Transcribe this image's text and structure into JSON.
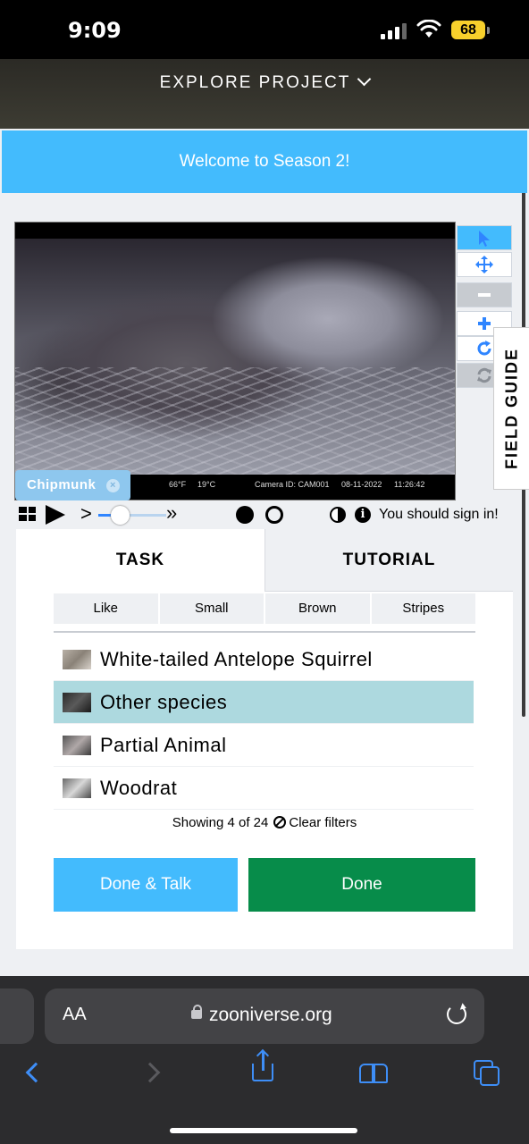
{
  "status_bar": {
    "time": "9:09",
    "battery": "68"
  },
  "header": {
    "explore_label": "EXPLORE PROJECT"
  },
  "banner": {
    "text": "Welcome to Season 2!"
  },
  "viewer": {
    "info": {
      "temp_f": "66°F",
      "temp_c": "19°C",
      "camera": "Camera ID: CAM001",
      "date": "08-11-2022",
      "time": "11:26:42"
    },
    "chip_label": "Chipmunk",
    "chip_remove": "×"
  },
  "tools": [
    {
      "name": "pointer",
      "icon": "arrow-pointer-icon"
    },
    {
      "name": "move",
      "icon": "move-arrows-icon"
    },
    {
      "name": "zoom-out",
      "icon": "minus-icon"
    },
    {
      "name": "zoom-in",
      "icon": "plus-icon"
    },
    {
      "name": "rotate",
      "icon": "rotate-icon"
    },
    {
      "name": "reset",
      "icon": "reset-icon"
    }
  ],
  "field_guide": {
    "label": "FIELD GUIDE"
  },
  "controls": {
    "speed_down": ">",
    "speed_up": "»",
    "speed_level": 0.25,
    "sign_in": "You should sign in!"
  },
  "tabs": {
    "task": "TASK",
    "tutorial": "TUTORIAL"
  },
  "filters": [
    "Like",
    "Small",
    "Brown",
    "Stripes"
  ],
  "choices": [
    {
      "label": "White-tailed Antelope Squirrel",
      "selected": false
    },
    {
      "label": "Other species",
      "selected": true
    },
    {
      "label": "Partial Animal",
      "selected": false
    },
    {
      "label": "Woodrat",
      "selected": false
    }
  ],
  "showing": {
    "text": "Showing 4 of 24",
    "clear": "Clear filters"
  },
  "buttons": {
    "done_talk": "Done & Talk",
    "done": "Done"
  },
  "browser": {
    "aa": "AA",
    "url": "zooniverse.org"
  },
  "colors": {
    "accent_blue": "#43bbfd",
    "done_green": "#078c4a",
    "selected_row": "#add9df"
  }
}
